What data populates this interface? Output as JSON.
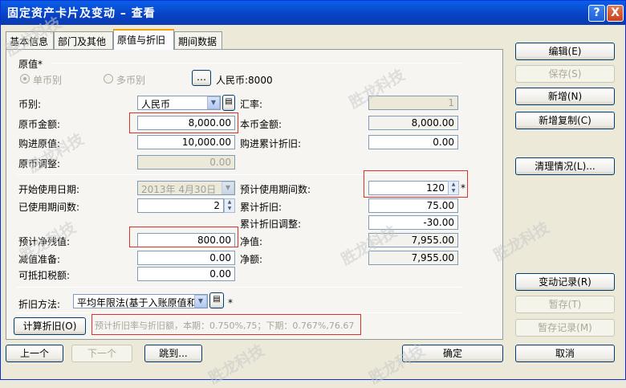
{
  "window": {
    "title": "固定资产卡片及变动 – 查看",
    "help_label": "?",
    "close_label": "X"
  },
  "tabs": [
    {
      "label": "基本信息"
    },
    {
      "label": "部门及其他"
    },
    {
      "label": "原值与折旧"
    },
    {
      "label": "期间数据"
    }
  ],
  "original": {
    "section_label": "原值*",
    "single_currency": "单币别",
    "multi_currency": "多币别",
    "rmb_text": "人民币:8000",
    "currency_label": "币别:",
    "currency_value": "人民币",
    "rate_label": "汇率:",
    "rate_value": "1",
    "orig_amount_label": "原币金额:",
    "orig_amount_value": "8,000.00",
    "local_amount_label": "本币金额:",
    "local_amount_value": "8,000.00",
    "purchase_value_label": "购进原值:",
    "purchase_value_value": "10,000.00",
    "purchase_dep_label": "购进累计折旧:",
    "purchase_dep_value": "0.00",
    "orig_adjust_label": "原币调整:",
    "orig_adjust_value": "0.00"
  },
  "dep": {
    "start_date_label": "开始使用日期:",
    "start_date_value": "2013年 4月30日",
    "expected_periods_label": "预计使用期间数:",
    "expected_periods_value": "120",
    "used_periods_label": "已使用期间数:",
    "used_periods_value": "2",
    "accum_dep_label": "累计折旧:",
    "accum_dep_value": "75.00",
    "accum_dep_adj_label": "累计折旧调整:",
    "accum_dep_adj_value": "-30.00",
    "residual_label": "预计净残值:",
    "residual_value": "800.00",
    "net_value_label": "净值:",
    "net_value_value": "7,955.00",
    "impairment_label": "减值准备:",
    "impairment_value": "0.00",
    "net_amount_label": "净额:",
    "net_amount_value": "7,955.00",
    "deductible_tax_label": "可抵扣税额:",
    "deductible_tax_value": "0.00",
    "method_label": "折旧方法:",
    "method_value": "平均年限法(基于入账原值和"
  },
  "calc": {
    "button": "计算折旧(O)",
    "hint": "预计折旧率与折旧额，本期：0.750%,75；下期：0.767%,76.67"
  },
  "side_buttons": {
    "edit": "编辑(E)",
    "save": "保存(S)",
    "add": "新增(N)",
    "add_copy": "新增复制(C)",
    "cleanup": "清理情况(L)...",
    "change_log": "变动记录(R)",
    "temp_save": "暂存(T)",
    "temp_log": "暂存记录(M)"
  },
  "bottom_buttons": {
    "prev": "上一个",
    "next": "下一个",
    "jump": "跳到...",
    "ok": "确定",
    "cancel": "取消"
  },
  "watermark": "胜龙科技"
}
